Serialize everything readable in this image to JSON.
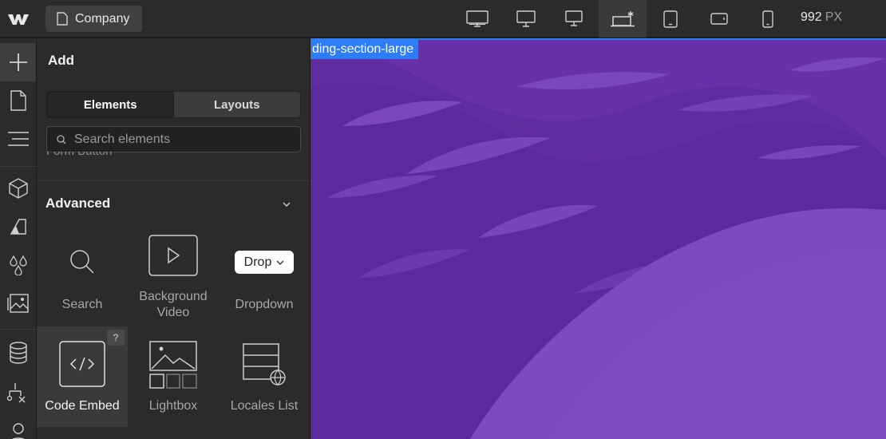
{
  "topbar": {
    "page_name": "Company",
    "breakpoints": [
      {
        "name": "desktop-xxl",
        "icon": "monitor-large-icon"
      },
      {
        "name": "desktop-xl",
        "icon": "monitor-icon"
      },
      {
        "name": "desktop-l",
        "icon": "monitor-small-icon"
      },
      {
        "name": "desktop-base",
        "icon": "laptop-star-icon",
        "active": true
      },
      {
        "name": "tablet",
        "icon": "tablet-icon"
      },
      {
        "name": "mobile-landscape",
        "icon": "phone-landscape-icon"
      },
      {
        "name": "mobile-portrait",
        "icon": "phone-icon"
      }
    ],
    "width_value": "992",
    "width_unit": "PX"
  },
  "rail": {
    "items": [
      {
        "name": "add-elements",
        "icon": "plus-icon",
        "active": true
      },
      {
        "name": "pages",
        "icon": "page-icon"
      },
      {
        "name": "navigator",
        "icon": "navigator-icon"
      },
      {
        "name": "components",
        "icon": "cube-icon"
      },
      {
        "name": "styles",
        "icon": "style-selectors-icon"
      },
      {
        "name": "variables",
        "icon": "droplets-icon"
      },
      {
        "name": "assets",
        "icon": "image-icon"
      },
      {
        "name": "cms",
        "icon": "database-icon"
      },
      {
        "name": "logic",
        "icon": "flow-icon"
      },
      {
        "name": "users",
        "icon": "user-icon"
      }
    ]
  },
  "panel": {
    "title": "Add",
    "tabs": [
      {
        "label": "Elements",
        "active": true
      },
      {
        "label": "Layouts",
        "active": false
      }
    ],
    "search_placeholder": "Search elements",
    "cut_off_label": "Form Button",
    "section_title": "Advanced",
    "elements": [
      {
        "label": "Search",
        "icon": "search-icon"
      },
      {
        "label": "Background Video",
        "icon": "play-icon"
      },
      {
        "label": "Dropdown",
        "icon": "dropdown-pill-icon",
        "pill_text": "Drop"
      },
      {
        "label": "Code Embed",
        "icon": "code-embed-icon",
        "active": true,
        "help": "?"
      },
      {
        "label": "Lightbox",
        "icon": "lightbox-icon"
      },
      {
        "label": "Locales List",
        "icon": "locales-list-icon"
      }
    ]
  },
  "canvas": {
    "selected_element": "ding-section-large",
    "colors": {
      "bg_dark": "#5b2a9c",
      "mid": "#6a35ad",
      "light": "#7a4cc0",
      "selection": "#2f7df6"
    }
  }
}
